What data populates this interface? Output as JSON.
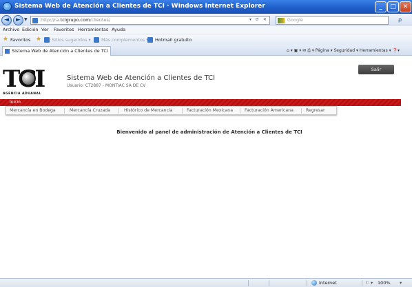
{
  "window": {
    "title": "Sistema Web de Atención a Clientes de TCI · Windows Internet Explorer",
    "min": "_",
    "max": "□",
    "close": "✕"
  },
  "nav": {
    "back": "◄",
    "forward": "►",
    "dropdown": "▼"
  },
  "address": {
    "url_prefix": "http://ra.",
    "url_domain": "tcigrupo.com",
    "url_suffix": "/clientes/",
    "tools": "▾ ⟳ ✕"
  },
  "search": {
    "engine": "Google",
    "go": "ρ"
  },
  "menu": [
    "Archivo",
    "Edición",
    "Ver",
    "Favoritos",
    "Herramientas",
    "Ayuda"
  ],
  "favorites": {
    "label": "Favoritos",
    "items": [
      "Sitios sugeridos ▾",
      "Más complementos ▾",
      "Hotmail gratuito"
    ]
  },
  "tab": {
    "label": "Sistema Web de Atención a Clientes de TCI"
  },
  "command_bar": "⌂ ▾  ▣ ▾  ✉  ⎙ ▾  Página ▾  Seguridad ▾  Herramientas ▾  ❓▾",
  "site": {
    "logo_text": "TCI",
    "logo_sub": "AGENCIA ADUANAL",
    "title": "Sistema Web de Atención a Clientes de TCI",
    "user_label": "Usuario:",
    "user_value": "CT2887 - MONTIAC SA DE CV",
    "logout": "Salir",
    "home": "Inicio",
    "submenu": [
      "Mercancía en Bodega",
      "Mercancía Cruzada",
      "Histórico de Mercancía",
      "Facturación Mexicana",
      "Facturación Americana",
      "Regresar"
    ],
    "welcome": "Bienvenido al panel de administración de Atención a Clientes de TCI"
  },
  "status": {
    "zone": "Internet",
    "zoom": "100%",
    "protected": "⚐ ▾",
    "zoom_arrow": "▾"
  }
}
